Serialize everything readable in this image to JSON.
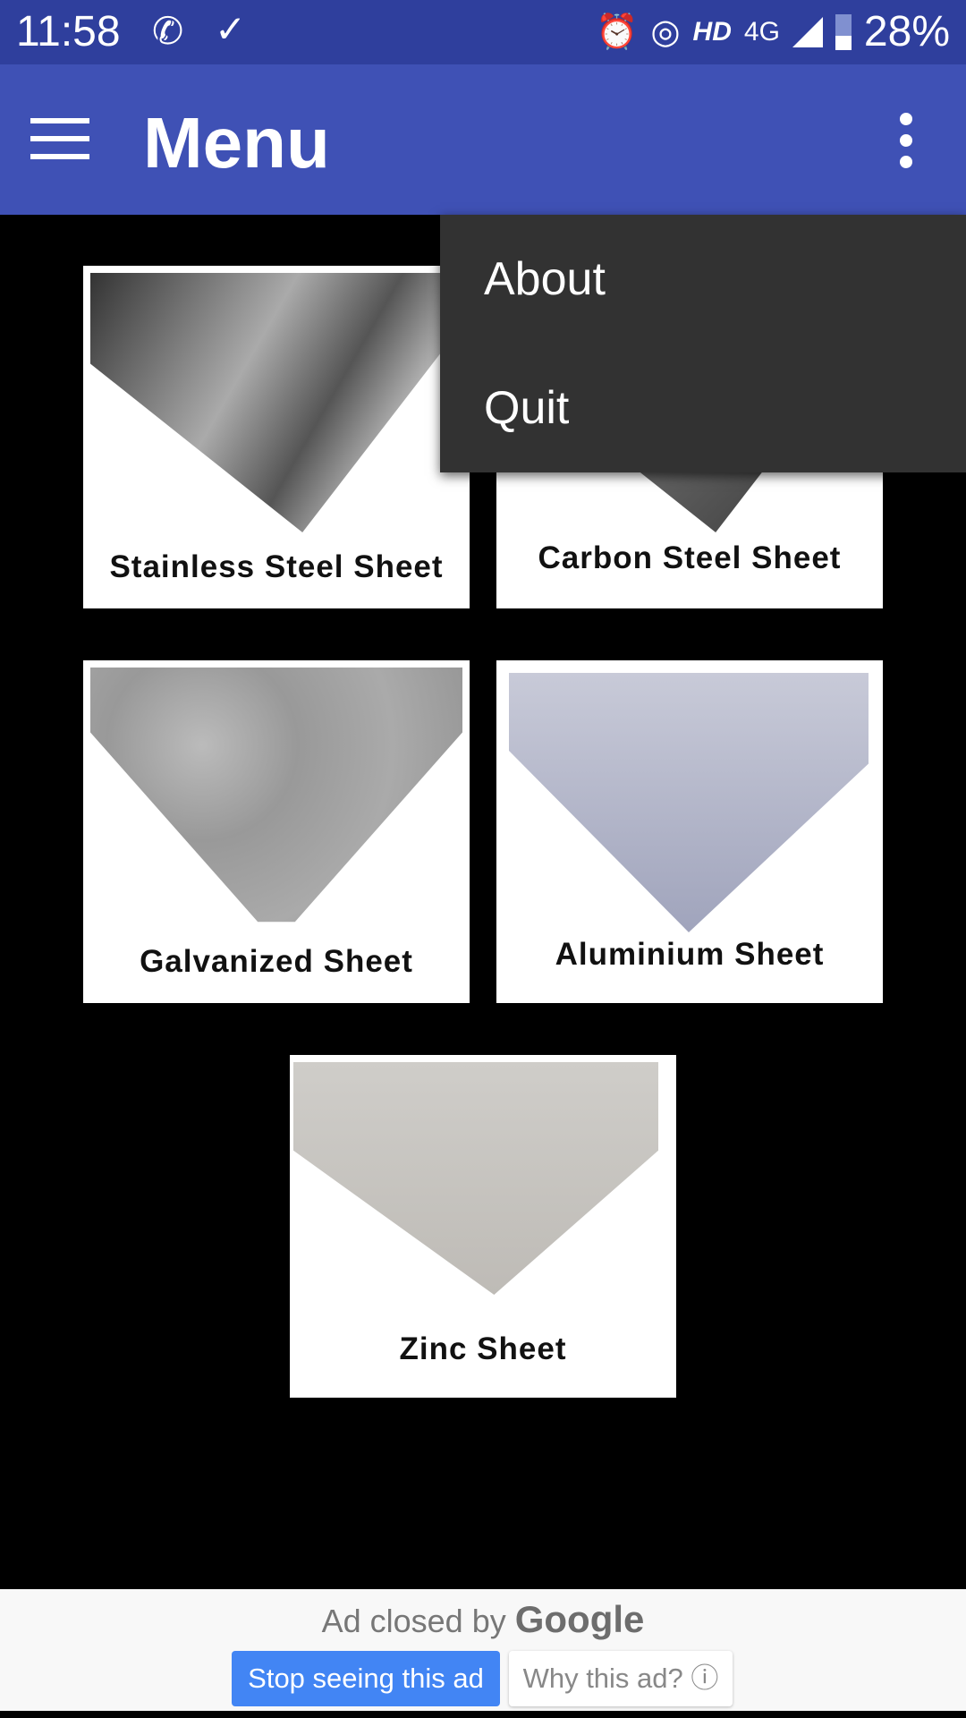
{
  "status_bar": {
    "time": "11:58",
    "network": "HD",
    "net_type": "4G",
    "battery": "28%",
    "icons": [
      "whatsapp-icon",
      "download-done-icon",
      "alarm-icon",
      "hotspot-icon",
      "signal-icon",
      "battery-charging-icon"
    ]
  },
  "app_bar": {
    "title": "Menu",
    "menu_icon": "hamburger-icon",
    "overflow_icon": "more-vert-icon"
  },
  "popup_menu": {
    "items": [
      {
        "label": "About"
      },
      {
        "label": "Quit"
      }
    ]
  },
  "products": [
    {
      "label": "Stainless Steel Sheet"
    },
    {
      "label": "Carbon Steel Sheet"
    },
    {
      "label": "Galvanized Sheet"
    },
    {
      "label": "Aluminium Sheet"
    },
    {
      "label": "Zinc Sheet"
    }
  ],
  "ad": {
    "text": "Ad closed by",
    "brand": "Google",
    "stop_label": "Stop seeing this ad",
    "why_label": "Why this ad?"
  },
  "colors": {
    "status": "#2f3f9d",
    "app_bar": "#3f51b5",
    "menu_bg": "#323232",
    "ad_button": "#4285f4"
  }
}
